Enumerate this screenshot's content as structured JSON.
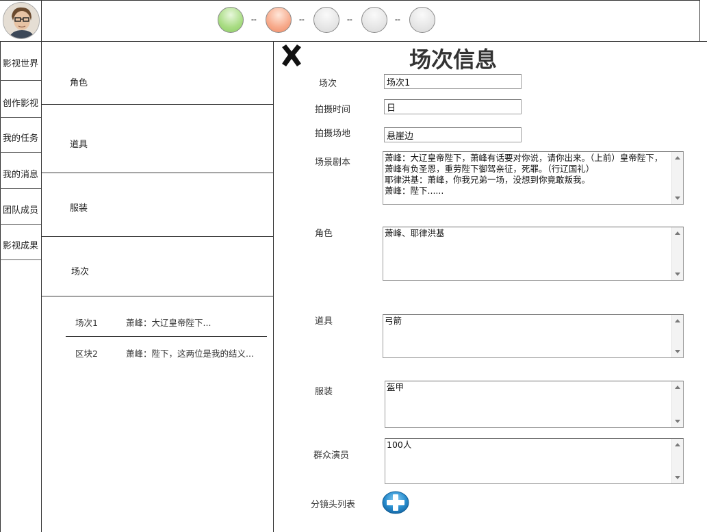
{
  "nav": {
    "items": [
      "影视世界",
      "创作影视",
      "我的任务",
      "我的消息",
      "团队成员",
      "影视成果"
    ]
  },
  "progress": {
    "steps": [
      {
        "state": "done",
        "color": "#a8dc82"
      },
      {
        "state": "current",
        "color": "#f7a98a"
      },
      {
        "state": "pending",
        "color": "#e6e6e6"
      },
      {
        "state": "pending",
        "color": "#e6e6e6"
      },
      {
        "state": "pending",
        "color": "#e6e6e6"
      }
    ]
  },
  "categories": {
    "role": "角色",
    "prop": "道具",
    "costume": "服装",
    "scene": "场次"
  },
  "scene_list": [
    {
      "name": "场次1",
      "desc": "萧峰：大辽皇帝陛下..."
    },
    {
      "name": "区块2",
      "desc": "萧峰：陛下，这两位是我的结义..."
    }
  ],
  "form": {
    "title": "场次信息",
    "scene_label": "场次",
    "scene_value": "场次1",
    "time_label": "拍摄时间",
    "time_value": "日",
    "location_label": "拍摄场地",
    "location_value": "悬崖边",
    "script_label": "场景剧本",
    "script_value": "萧峰：大辽皇帝陛下，萧峰有话要对你说，请你出来。（上前）皇帝陛下，萧峰有负圣恩，重劳陛下御驾亲征，死罪。（行辽国礼）\n耶律洪基：萧峰，你我兄弟一场，没想到你竟敢叛我。\n萧峰：陛下......",
    "role_label": "角色",
    "role_value": "萧峰、耶律洪基",
    "prop_label": "道具",
    "prop_value": "弓箭",
    "costume_label": "服装",
    "costume_value": "盔甲",
    "extras_label": "群众演员",
    "extras_value": "100人",
    "shots_label": "分镜头列表"
  },
  "icons": {
    "avatar": "user-avatar",
    "close": "close-icon",
    "add": "plus-icon"
  }
}
